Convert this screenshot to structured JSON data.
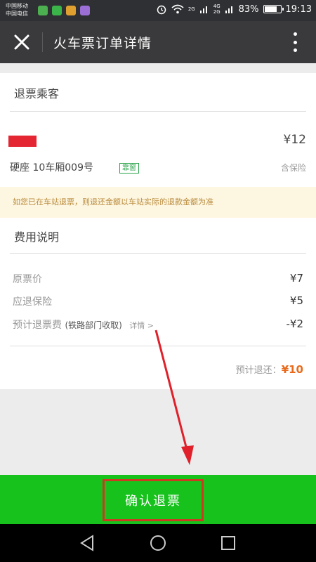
{
  "status_bar": {
    "carrier_1": "中国移动",
    "carrier_2": "中国电信",
    "net_top": "2G",
    "net_dual_top": "4G",
    "net_dual_bottom": "2G",
    "battery_percent": "83%",
    "battery_level": 0.83,
    "time": "19:13"
  },
  "header": {
    "title": "火车票订单详情",
    "close_icon": "close-icon",
    "more_icon": "more-vertical-icon"
  },
  "passenger": {
    "section_title": "退票乘客",
    "price": "¥12",
    "seat_info": "硬座  10车厢009号",
    "seat_tag": "靠窗",
    "insurance": "含保险"
  },
  "notice": "如您已在车站退票，则退还金额以车站实际的退款金额为准",
  "fees": {
    "section_title": "费用说明",
    "rows": [
      {
        "label": "原票价",
        "value": "¥7"
      },
      {
        "label": "应退保险",
        "value": "¥5"
      },
      {
        "label": "预计退票费",
        "sub": "(铁路部门收取)",
        "link": "详情 >",
        "value": "-¥2"
      }
    ],
    "total_label": "预计退还：",
    "total_value": "¥10"
  },
  "confirm_button": "确认退票",
  "colors": {
    "accent_green": "#17c21c",
    "highlight_red": "#cc3a22",
    "total_orange": "#e86a1a",
    "header_bg": "#3a3a3c"
  },
  "nav_icons": [
    "back-icon",
    "home-icon",
    "recents-icon"
  ]
}
